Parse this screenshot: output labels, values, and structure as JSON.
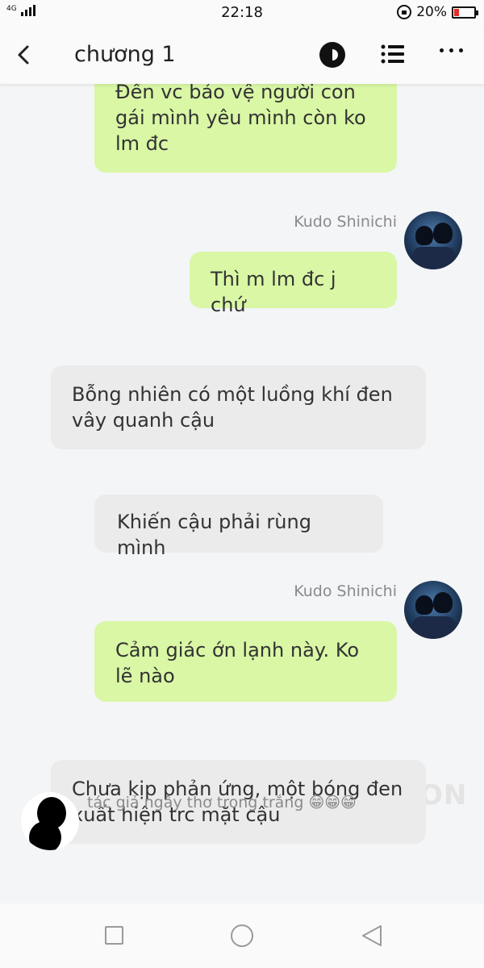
{
  "status_bar": {
    "network": "4G",
    "time": "22:18",
    "battery": "20%",
    "battery_level": 0.2,
    "battery_color": "#e0302a"
  },
  "header": {
    "title": "chương 1",
    "icons": [
      "back-icon",
      "theme-icon",
      "list-icon",
      "more-icon"
    ]
  },
  "messages": [
    {
      "type": "right",
      "text": "Đến vc bảo vệ người con gái mình yêu mình còn ko lm đc"
    },
    {
      "type": "right",
      "sender": "Kudo Shinichi",
      "text": "Thì m lm đc j chứ"
    },
    {
      "type": "narration",
      "text": "Bỗng nhiên có một luồng khí đen vây quanh cậu"
    },
    {
      "type": "narration",
      "text": "Khiến cậu phải rùng mình"
    },
    {
      "type": "right",
      "sender": "Kudo Shinichi",
      "text": "Cảm giác ớn lạnh này. Ko lẽ nào"
    },
    {
      "type": "narration",
      "text": "Chưa kịp phản ứng, một bóng đen xuất hiện trc mặt cậu"
    }
  ],
  "author_note": "tác giả ngây thơ trong trắng 😁😁😁",
  "watermark": "ON",
  "colors": {
    "bubble_green": "#d9f7a5",
    "bubble_gray": "#ebebeb",
    "background": "#f4f5f7"
  },
  "nav_bar": [
    "recent-apps-icon",
    "home-icon",
    "back-nav-icon"
  ]
}
